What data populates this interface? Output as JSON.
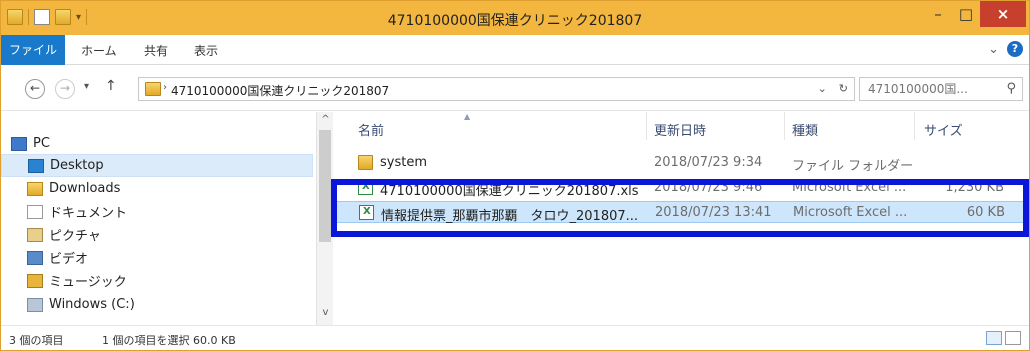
{
  "window": {
    "title": "4710100000国保連クリニック201807",
    "minimize": "–",
    "maximize": "□",
    "close": "×"
  },
  "ribbon": {
    "tabs": [
      "ファイル",
      "ホーム",
      "共有",
      "表示"
    ],
    "expand_icon": "⌄",
    "help_icon": "?"
  },
  "nav": {
    "back": "←",
    "forward": "→",
    "recent": "▾",
    "up": "↑",
    "address_crumb": "4710100000国保連クリニック201807",
    "address_dropdown": "⌄",
    "refresh": "↻",
    "search_placeholder": "4710100000国...",
    "search_icon": "⚲"
  },
  "sidebar": {
    "items": [
      {
        "label": "PC",
        "icon": "pc-icon"
      },
      {
        "label": "Desktop",
        "icon": "desktop-folder-icon",
        "selected": true
      },
      {
        "label": "Downloads",
        "icon": "downloads-folder-icon"
      },
      {
        "label": "ドキュメント",
        "icon": "documents-folder-icon"
      },
      {
        "label": "ピクチャ",
        "icon": "pictures-folder-icon"
      },
      {
        "label": "ビデオ",
        "icon": "videos-folder-icon"
      },
      {
        "label": "ミュージック",
        "icon": "music-folder-icon"
      },
      {
        "label": "Windows (C:)",
        "icon": "drive-icon"
      }
    ]
  },
  "files": {
    "columns": [
      "名前",
      "更新日時",
      "種類",
      "サイズ"
    ],
    "rows": [
      {
        "name": "system",
        "modified": "2018/07/23 9:34",
        "type": "ファイル フォルダー",
        "size": "",
        "icon": "folder-icon"
      },
      {
        "name": "4710100000国保連クリニック201807.xls",
        "modified": "2018/07/23 9:46",
        "type": "Microsoft Excel ...",
        "size": "1,230 KB",
        "icon": "excel-file-icon"
      },
      {
        "name": "情報提供票_那覇市那覇　タロウ_201807...",
        "modified": "2018/07/23 13:41",
        "type": "Microsoft Excel ...",
        "size": "60 KB",
        "icon": "excel-file-icon",
        "selected": true
      }
    ]
  },
  "status": {
    "count": "3 個の項目",
    "selection": "1 個の項目を選択  60.0 KB"
  },
  "colors": {
    "titlebar": "#f3b73f",
    "file_tab": "#1979ca",
    "close_button": "#c7402e",
    "selection": "#cde6fb",
    "highlight_box": "#0a16d8"
  }
}
